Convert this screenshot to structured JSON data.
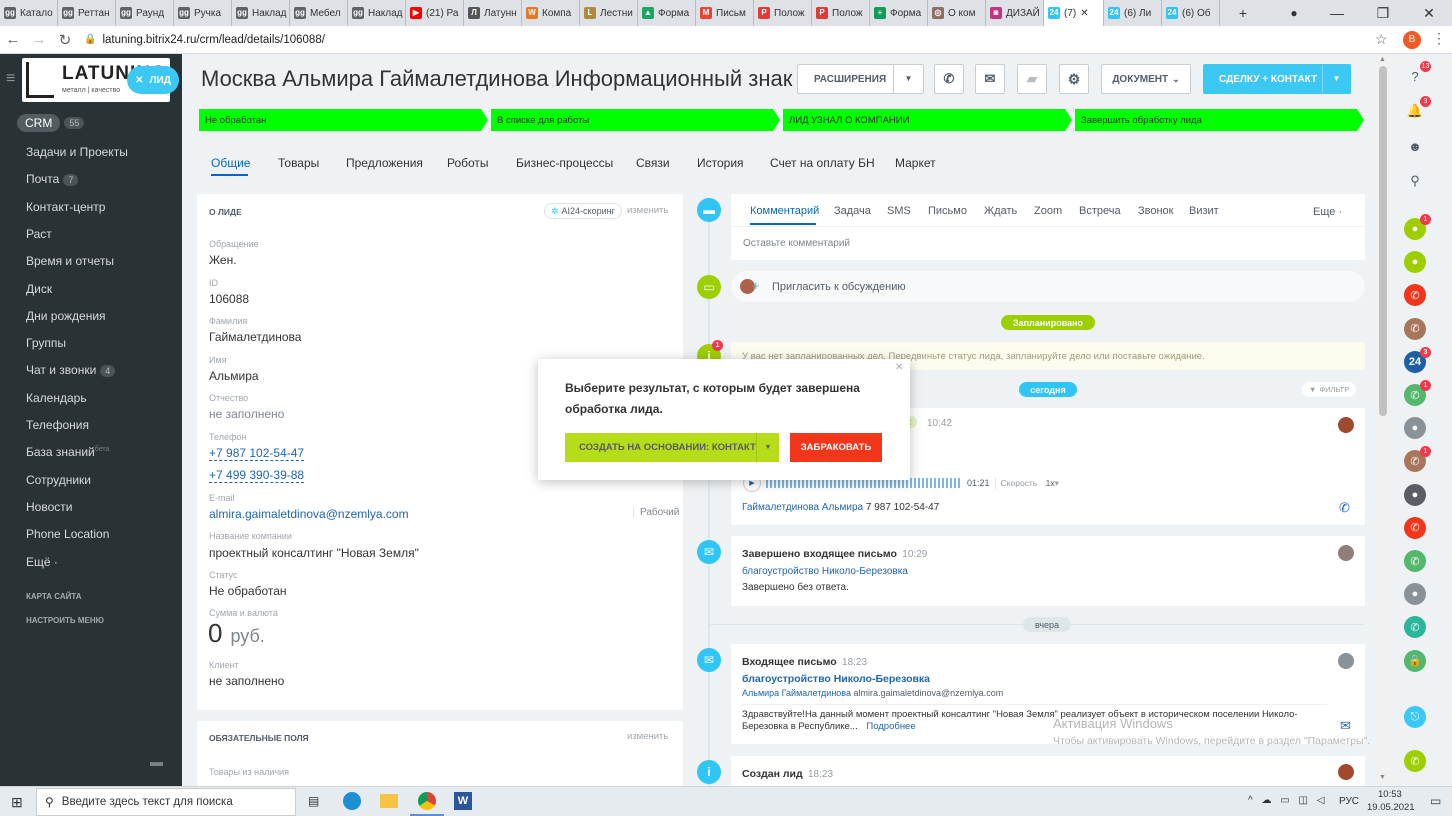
{
  "browser": {
    "tabs": [
      {
        "label": "Катало",
        "fav": "gg",
        "color": "#5f6368"
      },
      {
        "label": "Реттан",
        "fav": "gg",
        "color": "#5f6368"
      },
      {
        "label": "Раунд",
        "fav": "gg",
        "color": "#5f6368"
      },
      {
        "label": "Ручка",
        "fav": "gg",
        "color": "#5f6368"
      },
      {
        "label": "Наклад",
        "fav": "gg",
        "color": "#5f6368"
      },
      {
        "label": "Мебел",
        "fav": "gg",
        "color": "#5f6368"
      },
      {
        "label": "Наклад",
        "fav": "gg",
        "color": "#5f6368"
      },
      {
        "label": "(21) Ра",
        "fav": "▶",
        "color": "#ff0000"
      },
      {
        "label": "Латунн",
        "fav": "Л",
        "color": "#555"
      },
      {
        "label": "Компа",
        "fav": "W",
        "color": "#e87722"
      },
      {
        "label": "Лестни",
        "fav": "L",
        "color": "#b08a3c"
      },
      {
        "label": "Форма",
        "fav": "▲",
        "color": "#1fa463"
      },
      {
        "label": "Письм",
        "fav": "M",
        "color": "#ea4335"
      },
      {
        "label": "Полож",
        "fav": "P",
        "color": "#e53935"
      },
      {
        "label": "Полож",
        "fav": "P",
        "color": "#e53935"
      },
      {
        "label": "Форма",
        "fav": "+",
        "color": "#0f9d58"
      },
      {
        "label": "О ком",
        "fav": "◎",
        "color": "#8d6e63"
      },
      {
        "label": "ДИЗАЙ",
        "fav": "◙",
        "color": "#c13584"
      },
      {
        "label": "(7)",
        "fav": "24",
        "color": "#2fc6f6"
      },
      {
        "label": "(6) Ли",
        "fav": "24",
        "color": "#2fc6f6"
      },
      {
        "label": "(6) Об",
        "fav": "24",
        "color": "#2fc6f6"
      }
    ],
    "active_tab_index": 18,
    "url": "latuning.bitrix24.ru/crm/lead/details/106088/",
    "profile_letter": "B"
  },
  "leftmenu": {
    "logo_text": "LATUNING",
    "logo_sub": "металл | качество",
    "lead_tag": "ЛИД",
    "crm_label": "CRM",
    "crm_count": "55",
    "items": [
      {
        "label": "Задачи и Проекты",
        "count": ""
      },
      {
        "label": "Почта",
        "count": "7"
      },
      {
        "label": "Контакт-центр",
        "count": ""
      },
      {
        "label": "Раст",
        "count": ""
      },
      {
        "label": "Время и отчеты",
        "count": ""
      },
      {
        "label": "Диск",
        "count": ""
      },
      {
        "label": "Дни рождения",
        "count": ""
      },
      {
        "label": "Группы",
        "count": ""
      },
      {
        "label": "Чат и звонки",
        "count": "4"
      },
      {
        "label": "Календарь",
        "count": ""
      },
      {
        "label": "Телефония",
        "count": ""
      },
      {
        "label": "База знаний",
        "count": ""
      },
      {
        "label": "Сотрудники",
        "count": ""
      },
      {
        "label": "Новости",
        "count": ""
      },
      {
        "label": "Phone Location",
        "count": ""
      },
      {
        "label": "Ещё ·",
        "count": ""
      }
    ],
    "beta": "бета",
    "sitemap": "КАРТА САЙТА",
    "configure": "НАСТРОИТЬ МЕНЮ"
  },
  "header": {
    "title": "Москва Альмира Гаймалетдинова Информационный  знак",
    "extensions": "РАСШИРЕНИЯ",
    "document": "ДОКУМЕНТ",
    "deal_contact": "СДЕЛКУ + КОНТАКТ"
  },
  "stages": [
    "Не обработан",
    "В списке для работы",
    "ЛИД УЗНАЛ О КОМПАНИИ",
    "Завершить обработку лида"
  ],
  "tabs": [
    "Общие",
    "Товары",
    "Предложения",
    "Роботы",
    "Бизнес-процессы",
    "Связи",
    "История",
    "Счет на оплату БН",
    "Маркет"
  ],
  "about": {
    "title": "О ЛИДЕ",
    "ai_label": "AI24-скоринг",
    "edit": "изменить",
    "fields": [
      {
        "label": "Обращение",
        "value": "Жен."
      },
      {
        "label": "ID",
        "value": "106088"
      },
      {
        "label": "Фамилия",
        "value": "Гаймалетдинова"
      },
      {
        "label": "Имя",
        "value": "Альмира"
      },
      {
        "label": "Отчество",
        "value": "не заполнено"
      }
    ],
    "phone_label": "Телефон",
    "phones": [
      "+7 987 102-54-47",
      "+7 499 390-39-88"
    ],
    "email_label": "E-mail",
    "email": "almira.gaimaletdinova@nzemlya.com",
    "email_type": "Рабочий",
    "company_label": "Название компании",
    "company": "проектный консалтинг \"Новая Земля\"",
    "status_label": "Статус",
    "status": "Не обработан",
    "sum_label": "Сумма и валюта",
    "sum_value": "0",
    "sum_currency": "руб.",
    "client_label": "Клиент",
    "client": "не заполнено"
  },
  "required": {
    "title": "ОБЯЗАТЕЛЬНЫЕ ПОЛЯ",
    "edit": "изменить",
    "field": "Товары из наличия"
  },
  "timeline": {
    "tabs": [
      "Комментарий",
      "Задача",
      "SMS",
      "Письмо",
      "Ждать",
      "Zoom",
      "Встреча",
      "Звонок",
      "Визит"
    ],
    "more": "Еще ·",
    "comment_placeholder": "Оставьте комментарий",
    "invite": "Пригласить к обсуждению",
    "planned": "Запланировано",
    "no_plans": "У вас нет запланированных дел. Передвиньте статус лида, запланируйте дело или поставьте ожидание.",
    "today": "сегодня",
    "filter": "ФИЛЬТР",
    "call": {
      "tag": "к",
      "time": "10:42",
      "duration": "01:21",
      "speed_label": "Скорость",
      "speed": "1x",
      "caller": "Гаймалетдинова Альмира",
      "phone": "7 987 102-54-47"
    },
    "email1": {
      "title": "Завершено входящее письмо",
      "time": "10:29",
      "subject": "благоустройство Николо-Березовка",
      "body": "Завершено без ответа."
    },
    "yesterday": "вчера",
    "email2": {
      "title": "Входящее письмо",
      "time": "18:23",
      "subject": "благоустройство Николо-Березовка",
      "from_name": "Альмира Гаймалетдинова",
      "from_email": "almira.gaimaletdinova@nzemlya.com",
      "body": "Здравствуйте!На данный момент проектный консалтинг \"Новая Земля\" реализует объект в историческом поселении Николо-Березовка в Республике...",
      "more": "Подробнее"
    },
    "created": {
      "title": "Создан лид",
      "time": "18:23"
    }
  },
  "popup": {
    "text": "Выберите результат, с которым будет завершена обработка лида.",
    "create_btn": "СОЗДАТЬ НА ОСНОВАНИИ: КОНТАКТ",
    "reject_btn": "ЗАБРАКОВАТЬ"
  },
  "watermark": {
    "line1": "Активация Windows",
    "line2": "Чтобы активировать Windows, перейдите в раздел \"Параметры\"."
  },
  "rightbar": {
    "badges": [
      "13",
      "3",
      "",
      "",
      "1",
      "",
      "",
      "",
      "3",
      "1",
      "",
      "1",
      "",
      "",
      "",
      "",
      "",
      ""
    ],
    "chat_icon_text": "24"
  },
  "taskbar": {
    "search_placeholder": "Введите здесь текст для поиска",
    "lang": "РУС",
    "time": "10:53",
    "date": "19.05.2021"
  },
  "colors": {
    "stage_green": "#00ff00",
    "accent_blue": "#3bc8f5",
    "lime": "#9dcf00",
    "red": "#f1361b",
    "sidebar_bg": "#2a3236"
  }
}
